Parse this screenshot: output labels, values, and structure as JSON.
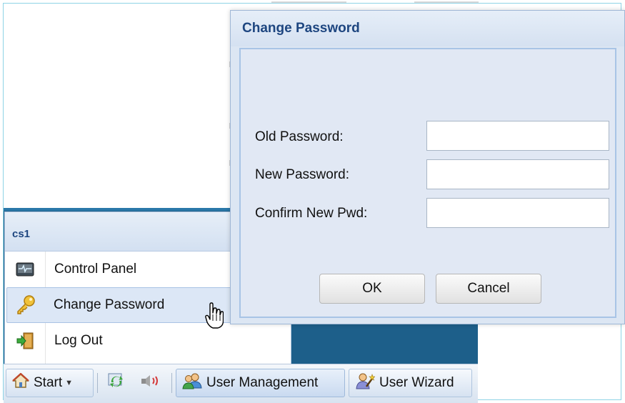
{
  "start_menu": {
    "title": "cs1",
    "items": [
      {
        "label": "Control Panel",
        "icon": "monitor-pulse-icon"
      },
      {
        "label": "Change Password",
        "icon": "key-icon"
      },
      {
        "label": "Log Out",
        "icon": "logout-door-icon"
      }
    ]
  },
  "taskbar": {
    "start_label": "Start",
    "buttons": [
      {
        "label": "User Management",
        "icon": "users-icon"
      },
      {
        "label": "User Wizard",
        "icon": "user-wizard-icon"
      }
    ],
    "quick_icons": [
      "refresh-icon",
      "speaker-icon"
    ]
  },
  "dialog": {
    "title": "Change Password",
    "fields": [
      {
        "label": "Old Password:",
        "value": ""
      },
      {
        "label": "New Password:",
        "value": ""
      },
      {
        "label": "Confirm New Pwd:",
        "value": ""
      }
    ],
    "ok_label": "OK",
    "cancel_label": "Cancel"
  },
  "colors": {
    "title_blue": "#1e4680",
    "desktop_blue": "#1d5f8a",
    "dialog_bg": "#dce6f3"
  }
}
